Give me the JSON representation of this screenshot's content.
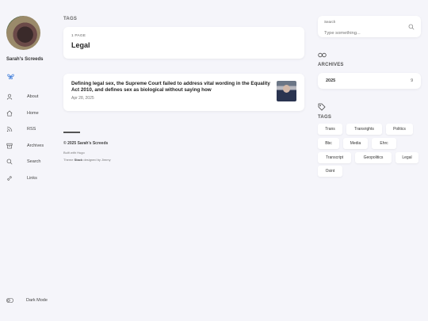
{
  "site": {
    "name": "Sarah's Screeds"
  },
  "nav": [
    {
      "label": "About",
      "icon": "user-icon"
    },
    {
      "label": "Home",
      "icon": "home-icon"
    },
    {
      "label": "RSS",
      "icon": "rss-icon"
    },
    {
      "label": "Archives",
      "icon": "archive-icon"
    },
    {
      "label": "Search",
      "icon": "search-icon"
    },
    {
      "label": "Links",
      "icon": "link-icon"
    }
  ],
  "dark_mode": {
    "label": "Dark Mode"
  },
  "main": {
    "section_title": "TAGS",
    "term": {
      "count": "1 PAGE",
      "title": "Legal"
    },
    "article": {
      "title": "Defining legal sex, the Supreme Court failed to address vital wording in the Equality Act 2010, and defines sex as biological without saying how",
      "date": "Apr 28, 2025"
    }
  },
  "footer": {
    "copyright": "© 2025 Sarah's Screeds",
    "built_with": "Built with Hugo",
    "theme_prefix": "Theme ",
    "theme_name": "Stack",
    "theme_suffix": " designed by Jimmy"
  },
  "search": {
    "label": "Search",
    "placeholder": "Type something..."
  },
  "archives": {
    "title": "ARCHIVES",
    "items": [
      {
        "year": "2025",
        "count": "9"
      }
    ]
  },
  "tags": {
    "title": "TAGS",
    "items": [
      "Trans",
      "Transrights",
      "Politics",
      "Bbc",
      "Media",
      "Ehrc",
      "Transcript",
      "Geopolitics",
      "Legal",
      "Osint"
    ]
  }
}
